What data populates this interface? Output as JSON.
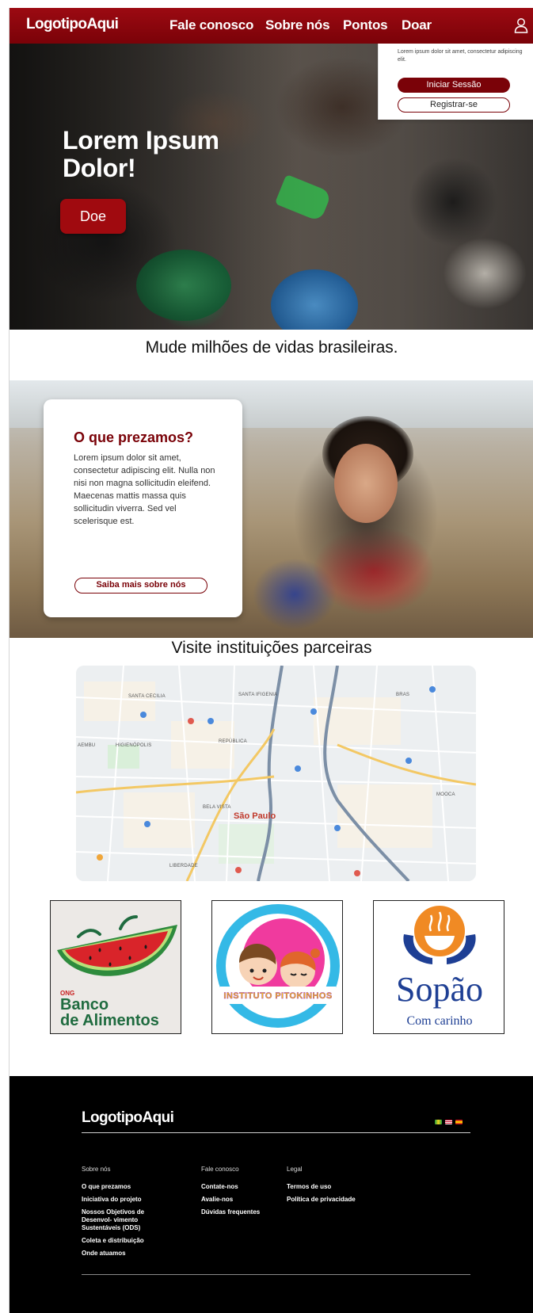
{
  "nav": {
    "logo": "LogotipoAqui",
    "items": [
      "Fale conosco",
      "Sobre nós",
      "Pontos",
      "Doar"
    ],
    "user_icon": "user-icon"
  },
  "login_dropdown": {
    "text": "Lorem ipsum dolor sit amet, consectetur adipiscing elit.",
    "login_label": "Iniciar Sessão",
    "register_label": "Registrar-se"
  },
  "hero": {
    "title": "Lorem Ipsum Dolor!",
    "button_label": "Doe"
  },
  "tagline": "Mude milhões de vidas brasileiras.",
  "values": {
    "title": "O que prezamos?",
    "text": "Lorem ipsum dolor sit amet, consectetur adipiscing elit. Nulla non nisi non magna sollicitudin eleifend. Maecenas mattis massa quis sollicitudin viverra. Sed vel scelerisque est.",
    "button_label": "Saiba mais sobre nós"
  },
  "partners": {
    "title": "Visite instituições parceiras",
    "map": {
      "city": "São Paulo",
      "labels": [
        "SANTA CECILIA",
        "SANTA IFIGENIA",
        "BRAS",
        "REPÚBLICA",
        "HIGIENÓPOLIS",
        "BELA VISTA",
        "LIBERDADE",
        "AEMBU",
        "MOOCA"
      ]
    },
    "logos": [
      {
        "ong": "ONG",
        "line1": "Banco",
        "line2": "de Alimentos"
      },
      {
        "name": "INSTITUTO PITOKINHOS"
      },
      {
        "name": "Sopão",
        "sub": "Com carinho"
      }
    ]
  },
  "footer": {
    "logo": "LogotipoAqui",
    "flags": [
      "brazil-flag",
      "usa-flag",
      "spain-flag"
    ],
    "columns": [
      {
        "heading": "Sobre nós",
        "links": [
          "O que prezamos",
          "Iniciativa do projeto",
          "Nossos Objetivos de Desenvol- vimento Sustentáveis (ODS)",
          "Coleta e distribuição",
          "Onde atuamos"
        ]
      },
      {
        "heading": "Fale conosco",
        "links": [
          "Contate-nos",
          "Avalie-nos",
          "Dúvidas frequentes"
        ]
      },
      {
        "heading": "Legal",
        "links": [
          "Termos de uso",
          "Política de privacidade"
        ]
      }
    ]
  },
  "colors": {
    "brand_red": "#7a0208",
    "accent_red": "#a00a0f",
    "footer_bg": "#000000"
  }
}
